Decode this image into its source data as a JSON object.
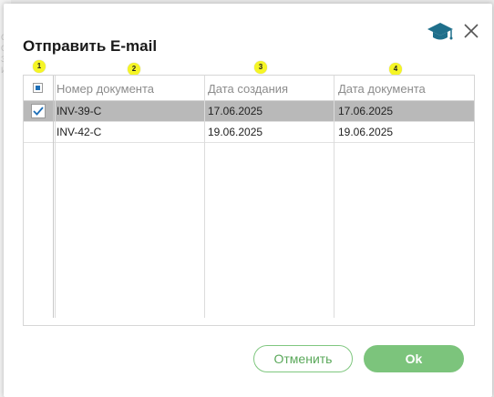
{
  "background": {
    "hints": [
      "С",
      "С",
      "З",
      "И"
    ]
  },
  "dialog": {
    "title": "Отправить E-mail",
    "help_icon": "graduation-cap-icon",
    "close_icon": "close-icon"
  },
  "markers": [
    "1",
    "2",
    "3",
    "4"
  ],
  "table": {
    "columns": [
      "Номер документа",
      "Дата создания",
      "Дата документа"
    ],
    "rows": [
      {
        "selected": true,
        "number": "INV-39-C",
        "created": "17.06.2025",
        "doc_date": "17.06.2025"
      },
      {
        "selected": false,
        "number": "INV-42-C",
        "created": "19.06.2025",
        "doc_date": "19.06.2025"
      }
    ]
  },
  "buttons": {
    "cancel": "Отменить",
    "ok": "Ok"
  },
  "colors": {
    "accent_green": "#7cc47c",
    "selected_row": "#b9b9b9",
    "checkbox_blue": "#1e6fb8",
    "marker_yellow": "#f5f526",
    "help_icon": "#1f6f8b"
  }
}
